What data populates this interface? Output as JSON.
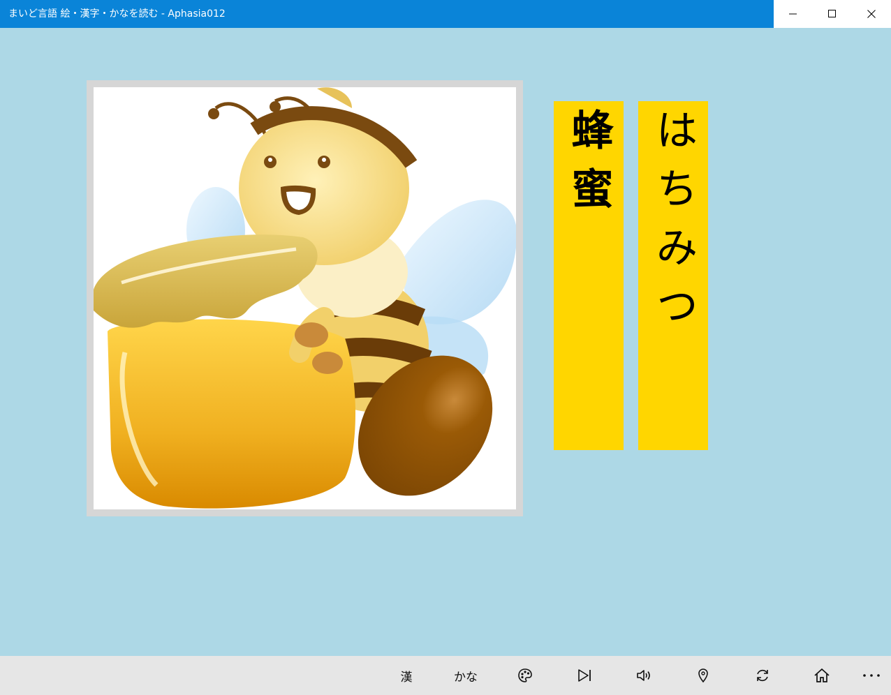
{
  "window": {
    "title": "まいど言語 絵・漢字・かなを読む - Aphasia012",
    "title_bar_color": "#0a84d8"
  },
  "picture": {
    "icon": "bee-with-honey-pot-illustration",
    "frame_color": "#d6d6d6"
  },
  "cards": {
    "color": "#ffd600",
    "kanji": "蜂蜜",
    "kana": "はちみつ"
  },
  "appbar": {
    "kanji_label": "漢",
    "kana_label": "かな",
    "icons": [
      "palette-icon",
      "skip-next-icon",
      "speaker-icon",
      "location-pin-icon",
      "refresh-icon",
      "home-icon",
      "more-icon"
    ]
  },
  "background_color": "#add8e6"
}
